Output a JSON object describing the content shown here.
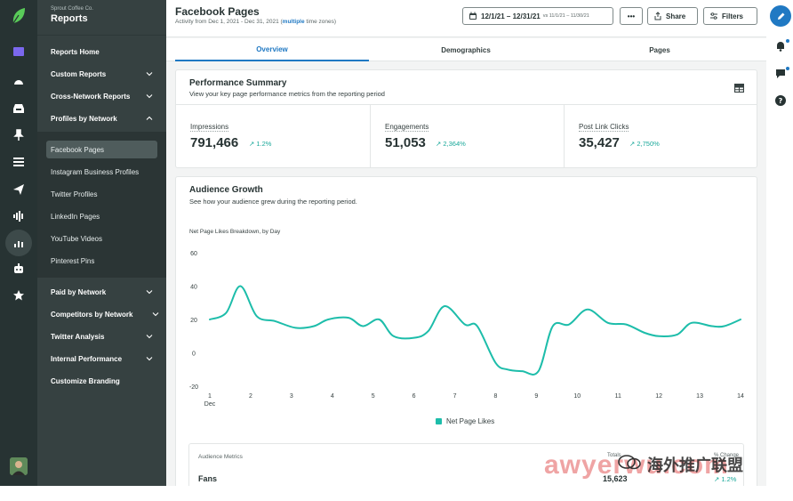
{
  "nav": {
    "org": "Sprout Coffee Co.",
    "title": "Reports",
    "items": [
      {
        "label": "Reports Home"
      },
      {
        "label": "Custom Reports"
      },
      {
        "label": "Cross-Network Reports"
      },
      {
        "label": "Profiles by Network"
      }
    ],
    "subitems": [
      {
        "label": "Facebook Pages"
      },
      {
        "label": "Instagram Business Profiles"
      },
      {
        "label": "Twitter Profiles"
      },
      {
        "label": "LinkedIn Pages"
      },
      {
        "label": "YouTube Videos"
      },
      {
        "label": "Pinterest Pins"
      }
    ],
    "items2": [
      {
        "label": "Paid by Network"
      },
      {
        "label": "Competitors by Network"
      },
      {
        "label": "Twitter Analysis"
      },
      {
        "label": "Internal Performance"
      },
      {
        "label": "Customize Branding"
      }
    ]
  },
  "header": {
    "title": "Facebook Pages",
    "subtitle_prefix": "Activity from Dec 1, 2021 - Dec 31, 2021 (",
    "subtitle_link": "multiple",
    "subtitle_suffix": " time zones)",
    "date_range": "12/1/21 – 12/31/21",
    "date_compare": "vs 11/1/21 – 11/30/21",
    "more_label": "•••",
    "share_label": "Share",
    "filters_label": "Filters"
  },
  "tabs": [
    {
      "label": "Overview",
      "active": true
    },
    {
      "label": "Demographics",
      "active": false
    },
    {
      "label": "Pages",
      "active": false
    }
  ],
  "performance": {
    "title": "Performance Summary",
    "subtitle": "View your key page performance metrics from the reporting period",
    "metrics": [
      {
        "label": "Impressions",
        "value": "791,466",
        "delta": "↗ 1.2%"
      },
      {
        "label": "Engagements",
        "value": "51,053",
        "delta": "↗ 2,364%"
      },
      {
        "label": "Post Link Clicks",
        "value": "35,427",
        "delta": "↗ 2,750%"
      }
    ]
  },
  "audience": {
    "title": "Audience Growth",
    "subtitle": "See how your audience grew during the reporting period.",
    "chart_label": "Net Page Likes Breakdown, by Day",
    "legend": "Net Page Likes"
  },
  "chart_data": {
    "type": "line",
    "title": "Net Page Likes Breakdown, by Day",
    "xlabel": "",
    "ylabel": "",
    "x_tick_labels": [
      "1",
      "2",
      "3",
      "4",
      "5",
      "6",
      "7",
      "8",
      "9",
      "10",
      "11",
      "12",
      "13",
      "14"
    ],
    "x_sub_label": "Dec",
    "y_ticks": [
      60,
      40,
      20,
      0,
      -20
    ],
    "ylim": [
      -20,
      60
    ],
    "xlim": [
      1,
      14
    ],
    "grid": false,
    "legend_position": "bottom",
    "series": [
      {
        "name": "Net Page Likes",
        "color": "#1dbdaa",
        "x": [
          1,
          1.4,
          1.75,
          2.15,
          2.6,
          3.1,
          3.55,
          3.9,
          4.4,
          4.75,
          5.15,
          5.5,
          6.0,
          6.35,
          6.75,
          7.25,
          7.55,
          8.0,
          8.3,
          8.65,
          9.05,
          9.4,
          9.8,
          10.25,
          10.75,
          11.2,
          11.65,
          12.0,
          12.45,
          12.8,
          13.3,
          13.6,
          14.0
        ],
        "values": [
          20,
          24,
          40,
          22,
          19,
          15,
          16,
          20,
          21,
          16,
          20,
          10,
          9,
          13,
          28,
          17,
          16,
          -6,
          -10,
          -11,
          -11,
          16,
          17,
          26,
          18,
          17,
          12,
          10,
          11,
          18,
          16,
          16,
          20
        ]
      }
    ]
  },
  "bottom": {
    "label": "Audience Metrics",
    "col_totals": "Totals",
    "col_change": "% Change",
    "fans_label": "Fans",
    "fans_value": "15,623",
    "fans_change": "↗ 1.2%"
  },
  "watermark": {
    "latin": "awyerwu.com",
    "cn": "海外推广联盟"
  },
  "colors": {
    "rail": "#273333",
    "nav": "#364141",
    "accent": "#2079c3",
    "positive": "#1aa89a",
    "line": "#1dbdaa"
  }
}
